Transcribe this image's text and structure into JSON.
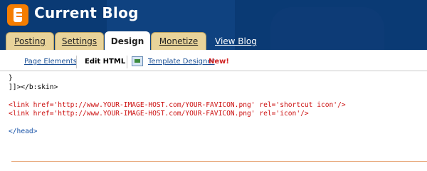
{
  "header": {
    "title": "Current Blog",
    "logo_icon": "blogger-logo-icon",
    "bg_color": "#0a3a74",
    "tabs": [
      {
        "label": "Posting"
      },
      {
        "label": "Settings"
      },
      {
        "label": "Design",
        "active": true
      },
      {
        "label": "Monetize"
      }
    ],
    "view_blog": "View Blog"
  },
  "subnav": {
    "items": [
      {
        "label": "Page Elements"
      },
      {
        "label": "Edit HTML",
        "active": true
      },
      {
        "label": "Template Designer"
      }
    ],
    "new_badge": "New!",
    "template_designer_icon": "template-designer-icon"
  },
  "editor": {
    "lines": [
      {
        "text": "}",
        "color": "black"
      },
      {
        "text": "]]></b:skin>",
        "color": "black"
      },
      {
        "text": "",
        "color": "black"
      },
      {
        "text": "<link href='http://www.YOUR-IMAGE-HOST.com/YOUR-FAVICON.png' rel='shortcut icon'/>",
        "color": "red"
      },
      {
        "text": "<link href='http://www.YOUR-IMAGE-HOST.com/YOUR-FAVICON.png' rel='icon'/>",
        "color": "red"
      },
      {
        "text": "",
        "color": "black"
      },
      {
        "text": "</head>",
        "color": "blue"
      }
    ]
  }
}
